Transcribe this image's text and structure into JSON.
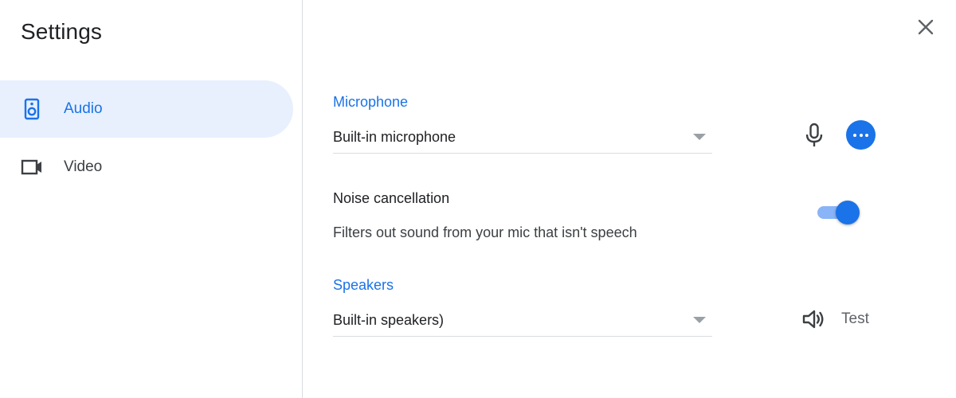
{
  "header": {
    "title": "Settings"
  },
  "sidebar": {
    "items": [
      {
        "label": "Audio",
        "icon": "speaker-device-icon",
        "active": true
      },
      {
        "label": "Video",
        "icon": "videocam-icon",
        "active": false
      }
    ]
  },
  "audio": {
    "microphone": {
      "label": "Microphone",
      "selected": "Built-in microphone"
    },
    "noise_cancellation": {
      "title": "Noise cancellation",
      "description": "Filters out sound from your mic that isn't speech",
      "enabled": true
    },
    "speakers": {
      "label": "Speakers",
      "selected": "Built-in speakers)",
      "test_label": "Test"
    }
  },
  "icons": {
    "close": "close-icon",
    "mic": "mic-icon",
    "more": "more-horiz-icon",
    "speaker": "volume-icon"
  },
  "colors": {
    "accent": "#1a73e8",
    "active_nav_bg": "#e8f0fe",
    "toggle_track": "#8ab4f8",
    "divider": "#dadce0"
  }
}
